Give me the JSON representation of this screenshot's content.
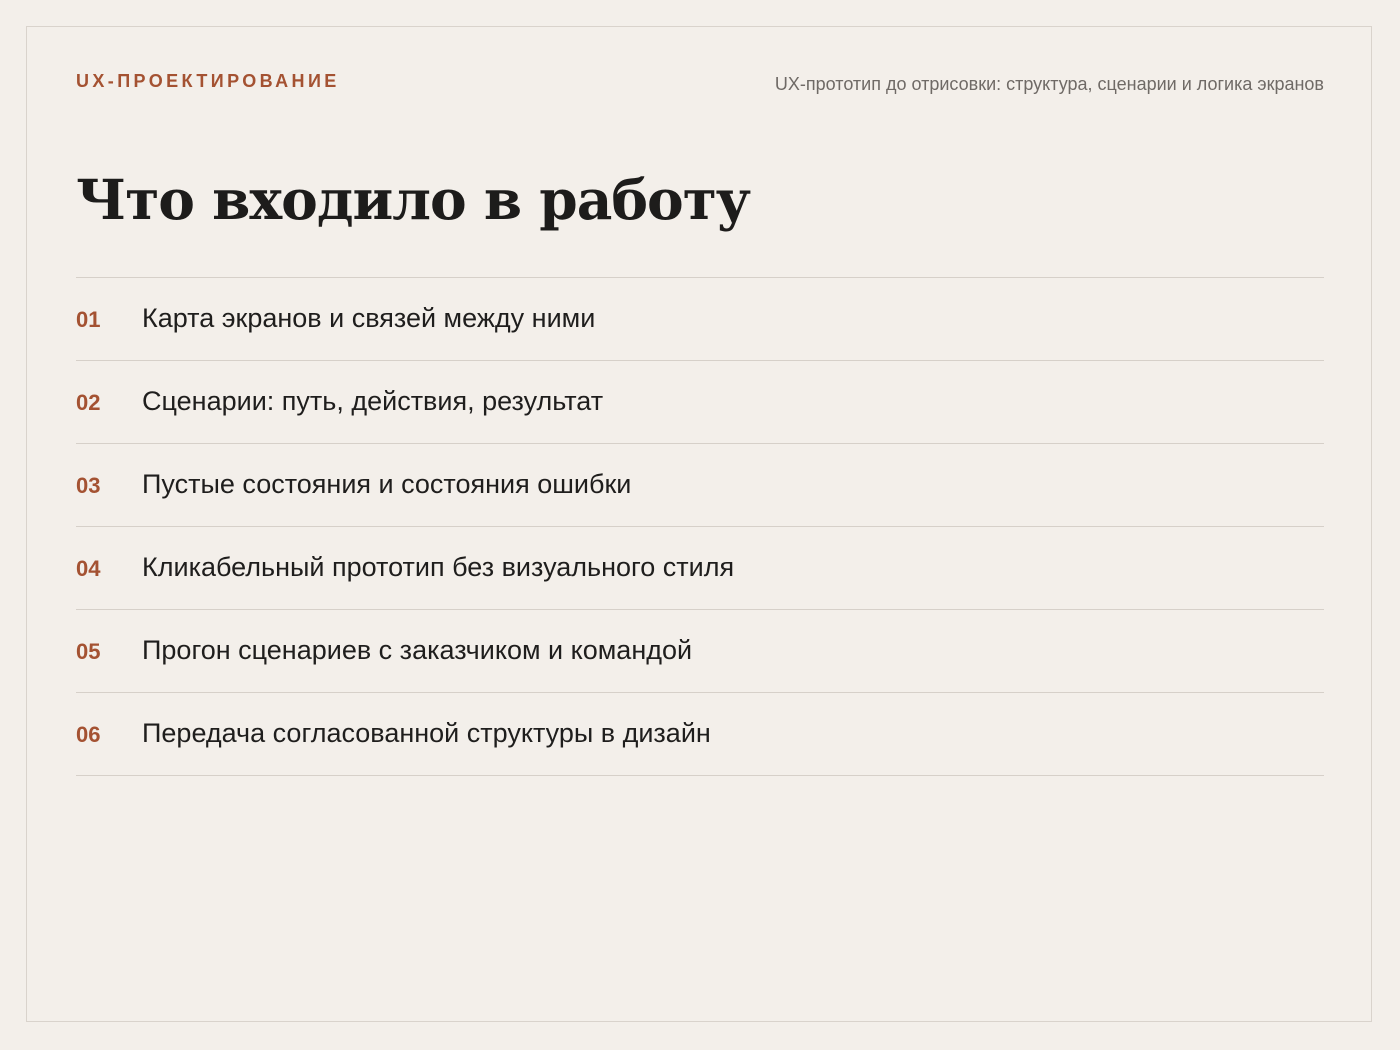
{
  "header": {
    "eyebrow": "UX-ПРОЕКТИРОВАНИЕ",
    "subtitle": "UX-прототип до отрисовки: структура, сценарии и логика экранов"
  },
  "title": "Что входило в работу",
  "items": [
    {
      "num": "01",
      "text": "Карта экранов и связей между ними"
    },
    {
      "num": "02",
      "text": "Сценарии: путь, действия, результат"
    },
    {
      "num": "03",
      "text": "Пустые состояния и состояния ошибки"
    },
    {
      "num": "04",
      "text": "Кликабельный прототип без визуального стиля"
    },
    {
      "num": "05",
      "text": "Прогон сценариев с заказчиком и командой"
    },
    {
      "num": "06",
      "text": "Передача согласованной структуры в дизайн"
    }
  ],
  "colors": {
    "background": "#f3efea",
    "accent": "#a45232",
    "text": "#1f1e1d",
    "muted": "#6f6a66",
    "divider": "#d6d0c9"
  }
}
